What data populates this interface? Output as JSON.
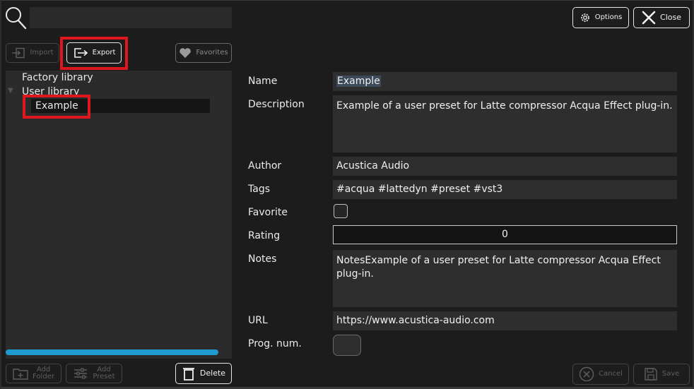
{
  "header": {
    "search_placeholder": "",
    "options_label": "Options",
    "close_label": "Close"
  },
  "toolbar": {
    "import_label": "Import",
    "export_label": "Export",
    "favorites_label": "Favorites"
  },
  "tree": {
    "factory_label": "Factory library",
    "user_label": "User library",
    "selected_item": "Example"
  },
  "bottom": {
    "add_folder_line1": "Add",
    "add_folder_line2": "Folder",
    "add_preset_line1": "Add",
    "add_preset_line2": "Preset",
    "delete_label": "Delete",
    "cancel_label": "Cancel",
    "save_label": "Save"
  },
  "form": {
    "labels": {
      "name": "Name",
      "description": "Description",
      "author": "Author",
      "tags": "Tags",
      "favorite": "Favorite",
      "rating": "Rating",
      "notes": "Notes",
      "url": "URL",
      "prog_num": "Prog. num."
    },
    "values": {
      "name": "Example",
      "description": "Example of a user preset for Latte compressor Acqua Effect plug-in.",
      "author": "Acustica Audio",
      "tags": "#acqua #lattedyn #preset #vst3",
      "favorite": false,
      "rating": "0",
      "notes": "NotesExample of a user preset for Latte compressor Acqua Effect\nplug-in.",
      "url": "https://www.acustica-audio.com",
      "prog_num": ""
    }
  },
  "colors": {
    "highlight": "#e0161f",
    "scrollbar": "#1e9bd0",
    "background": "#1c1c1c",
    "field_bg": "#2e2e2e"
  }
}
